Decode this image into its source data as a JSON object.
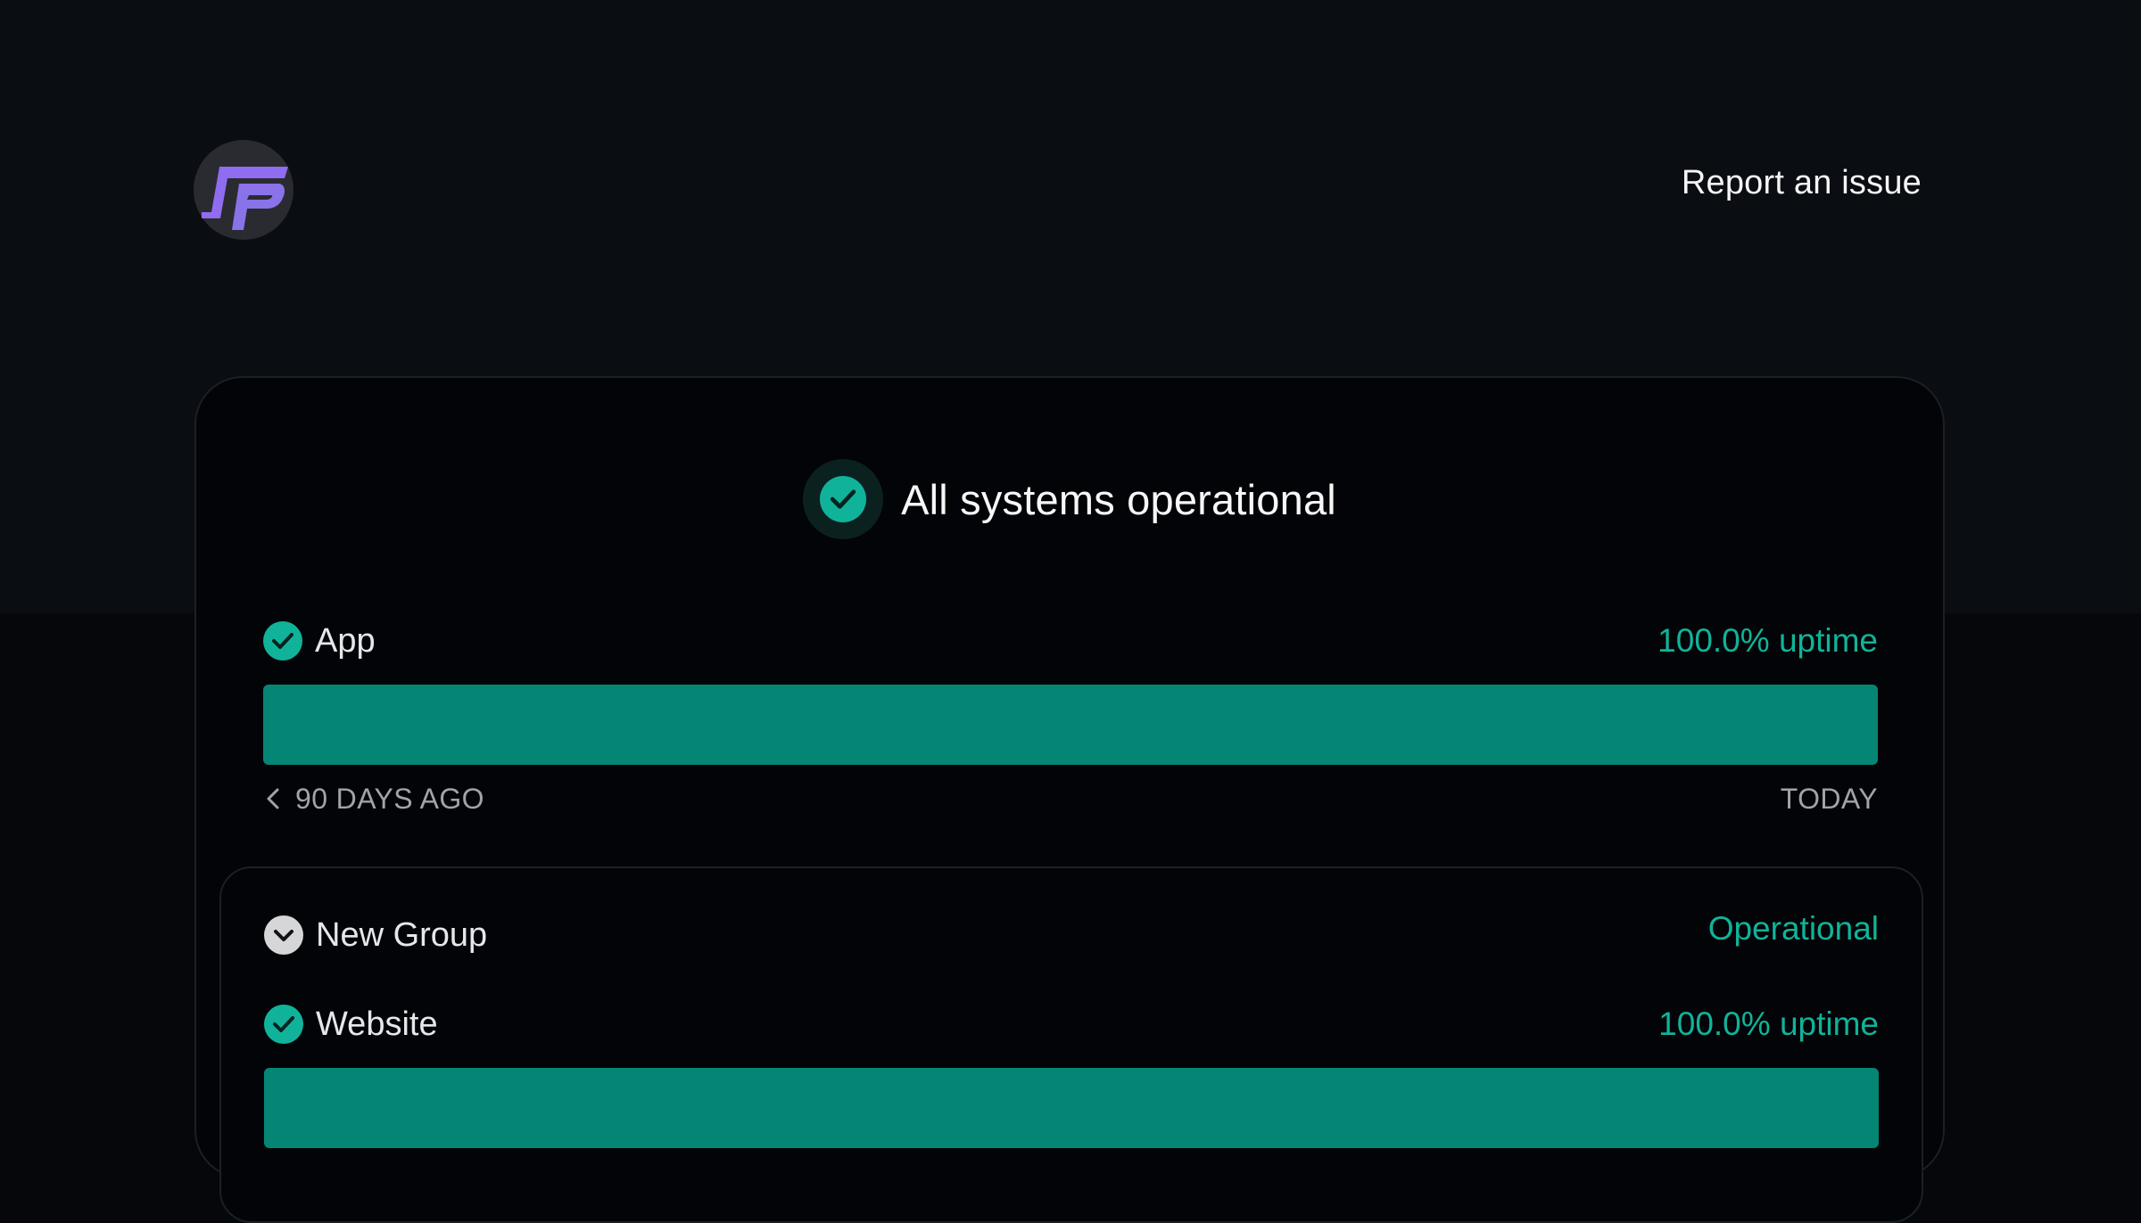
{
  "header": {
    "logo_alt": "FP",
    "report_link_label": "Report an issue"
  },
  "status": {
    "overall_title": "All systems operational"
  },
  "monitors": [
    {
      "name": "App",
      "uptime_label": "100.0% uptime",
      "uptime_fraction": 1.0,
      "axis_start_label": "90 DAYS AGO",
      "axis_end_label": "TODAY"
    }
  ],
  "group": {
    "name": "New Group",
    "status_label": "Operational",
    "monitors": [
      {
        "name": "Website",
        "uptime_label": "100.0% uptime",
        "uptime_fraction": 1.0
      }
    ]
  },
  "colors": {
    "page_background": "#05070b",
    "header_background": "#0a0d12",
    "card_background": "#020407",
    "accent_green": "#10b39a",
    "bar_green": "#058674",
    "logo_purple": "#8f6cf0"
  },
  "icons": {
    "overall_status": "check-circle-icon",
    "monitor_status": "check-circle-icon",
    "group_toggle": "chevron-down-circle-icon",
    "axis_back": "chevron-left-icon"
  }
}
